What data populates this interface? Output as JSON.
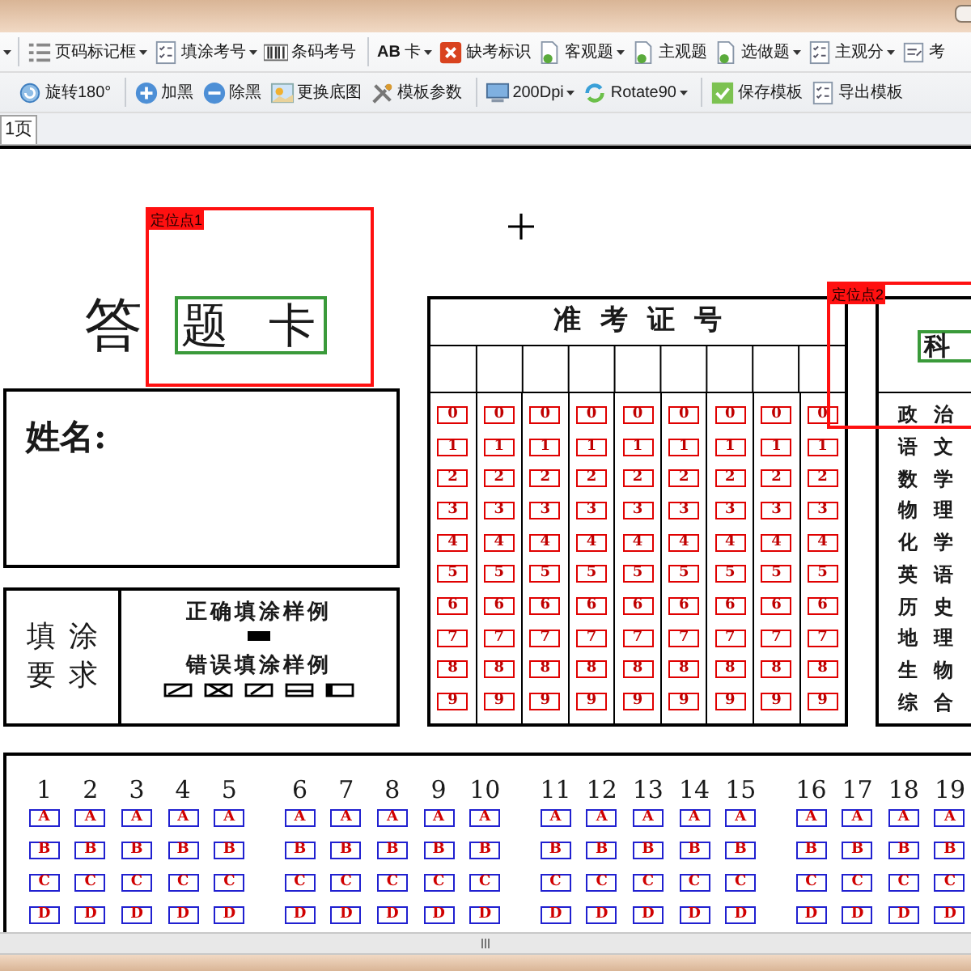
{
  "toolbars": [
    {
      "groups": [
        [
          {
            "label": "页码标记框",
            "dropdown": true
          },
          {
            "label": "填涂考号",
            "dropdown": true
          },
          {
            "label": "条码考号",
            "dropdown": false
          }
        ],
        [
          {
            "label": "**AB** 卡",
            "dropdown": true
          },
          {
            "label": "缺考标识",
            "dropdown": false
          },
          {
            "label": "客观题",
            "dropdown": true
          },
          {
            "label": "主观题",
            "dropdown": false
          },
          {
            "label": "选做题",
            "dropdown": true
          },
          {
            "label": "主观分",
            "dropdown": true
          },
          {
            "label": "考",
            "dropdown": false
          }
        ]
      ]
    },
    {
      "groups": [
        [
          {
            "label": "旋转180°",
            "dropdown": false
          }
        ],
        [
          {
            "label": "加黑",
            "dropdown": false
          },
          {
            "label": "除黑",
            "dropdown": false
          },
          {
            "label": "更换底图",
            "dropdown": false
          },
          {
            "label": "模板参数",
            "dropdown": false
          }
        ],
        [
          {
            "label": "200Dpi",
            "dropdown": true
          },
          {
            "label": "Rotate90",
            "dropdown": true
          }
        ],
        [
          {
            "label": "保存模板",
            "dropdown": false
          },
          {
            "label": "导出模板",
            "dropdown": false
          }
        ]
      ]
    }
  ],
  "tabs": [
    {
      "label": "1页",
      "selected": true
    }
  ],
  "sheet": {
    "title_prefix": "答",
    "title_boxed": "题 卡",
    "anchors": [
      {
        "label": "定位点1"
      },
      {
        "label": "定位点2"
      }
    ],
    "name_label": "姓名:",
    "fill_rules": {
      "label_lines": [
        "填涂",
        "要求"
      ],
      "correct": "正确填涂样例",
      "wrong": "错误填涂样例"
    },
    "exam_number": {
      "title": "准考证号",
      "columns": [
        {
          "bubbles": [
            "0",
            "1",
            "2",
            "3",
            "4",
            "5",
            "6",
            "7",
            "8",
            "9"
          ]
        },
        {
          "bubbles": [
            "0",
            "1",
            "2",
            "3",
            "4",
            "5",
            "6",
            "7",
            "8",
            "9"
          ]
        },
        {
          "bubbles": [
            "0",
            "1",
            "2",
            "3",
            "4",
            "5",
            "6",
            "7",
            "8",
            "9"
          ]
        },
        {
          "bubbles": [
            "0",
            "1",
            "2",
            "3",
            "4",
            "5",
            "6",
            "7",
            "8",
            "9"
          ]
        },
        {
          "bubbles": [
            "0",
            "1",
            "2",
            "3",
            "4",
            "5",
            "6",
            "7",
            "8",
            "9"
          ]
        },
        {
          "bubbles": [
            "0",
            "1",
            "2",
            "3",
            "4",
            "5",
            "6",
            "7",
            "8",
            "9"
          ]
        },
        {
          "bubbles": [
            "0",
            "1",
            "2",
            "3",
            "4",
            "5",
            "6",
            "7",
            "8",
            "9"
          ]
        },
        {
          "bubbles": [
            "0",
            "1",
            "2",
            "3",
            "4",
            "5",
            "6",
            "7",
            "8",
            "9"
          ]
        },
        {
          "bubbles": [
            "0",
            "1",
            "2",
            "3",
            "4",
            "5",
            "6",
            "7",
            "8",
            "9"
          ]
        }
      ]
    },
    "subject": {
      "title": "科",
      "items": [
        "政治",
        "语文",
        "数学",
        "物理",
        "化学",
        "英语",
        "历史",
        "地理",
        "生物",
        "综合"
      ]
    },
    "question_groups": [
      [
        {
          "number": "1",
          "options": [
            "A",
            "B",
            "C",
            "D"
          ]
        },
        {
          "number": "2",
          "options": [
            "A",
            "B",
            "C",
            "D"
          ]
        },
        {
          "number": "3",
          "options": [
            "A",
            "B",
            "C",
            "D"
          ]
        },
        {
          "number": "4",
          "options": [
            "A",
            "B",
            "C",
            "D"
          ]
        },
        {
          "number": "5",
          "options": [
            "A",
            "B",
            "C",
            "D"
          ]
        }
      ],
      [
        {
          "number": "6",
          "options": [
            "A",
            "B",
            "C",
            "D"
          ]
        },
        {
          "number": "7",
          "options": [
            "A",
            "B",
            "C",
            "D"
          ]
        },
        {
          "number": "8",
          "options": [
            "A",
            "B",
            "C",
            "D"
          ]
        },
        {
          "number": "9",
          "options": [
            "A",
            "B",
            "C",
            "D"
          ]
        },
        {
          "number": "10",
          "options": [
            "A",
            "B",
            "C",
            "D"
          ]
        }
      ],
      [
        {
          "number": "11",
          "options": [
            "A",
            "B",
            "C",
            "D"
          ]
        },
        {
          "number": "12",
          "options": [
            "A",
            "B",
            "C",
            "D"
          ]
        },
        {
          "number": "13",
          "options": [
            "A",
            "B",
            "C",
            "D"
          ]
        },
        {
          "number": "14",
          "options": [
            "A",
            "B",
            "C",
            "D"
          ]
        },
        {
          "number": "15",
          "options": [
            "A",
            "B",
            "C",
            "D"
          ]
        }
      ],
      [
        {
          "number": "16",
          "options": [
            "A",
            "B",
            "C",
            "D"
          ]
        },
        {
          "number": "17",
          "options": [
            "A",
            "B",
            "C",
            "D"
          ]
        },
        {
          "number": "18",
          "options": [
            "A",
            "B",
            "C",
            "D"
          ]
        },
        {
          "number": "19",
          "options": [
            "A",
            "B",
            "C",
            "D"
          ]
        }
      ]
    ]
  }
}
